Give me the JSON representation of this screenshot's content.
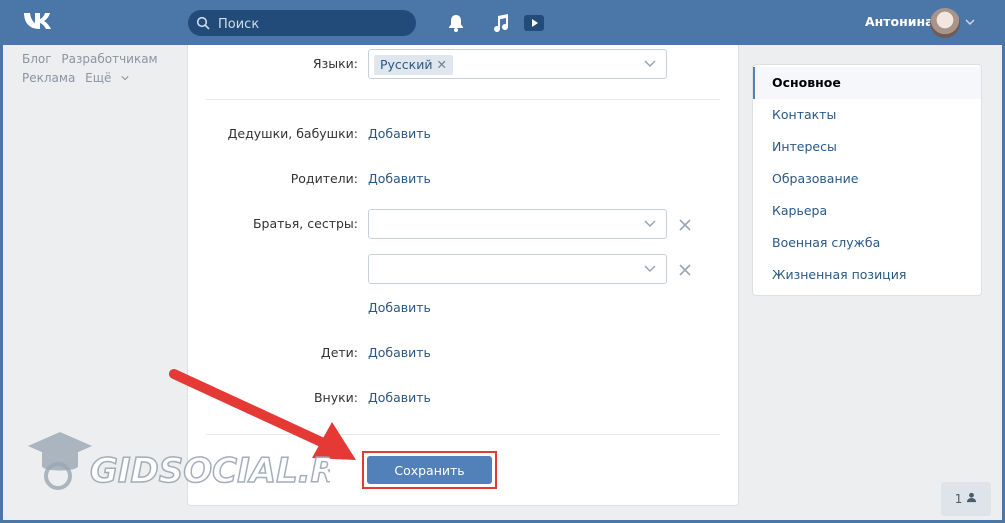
{
  "header": {
    "search_placeholder": "Поиск",
    "user_name": "Антонина",
    "brand_color": "#4a76a8"
  },
  "left_links": [
    "Блог",
    "Разработчикам",
    "Реклама",
    "Ещё"
  ],
  "form": {
    "languages_label": "Языки:",
    "language_tag": "Русский",
    "grandparents_label": "Дедушки, бабушки:",
    "parents_label": "Родители:",
    "siblings_label": "Братья, сестры:",
    "children_label": "Дети:",
    "grandchildren_label": "Внуки:",
    "add_label": "Добавить",
    "save_label": "Сохранить"
  },
  "menu": {
    "items": [
      "Основное",
      "Контакты",
      "Интересы",
      "Образование",
      "Карьера",
      "Военная служба",
      "Жизненная позиция"
    ],
    "active_index": 0
  },
  "watermark": "GIDSOCIAL.RU",
  "footer_badge_count": "1"
}
